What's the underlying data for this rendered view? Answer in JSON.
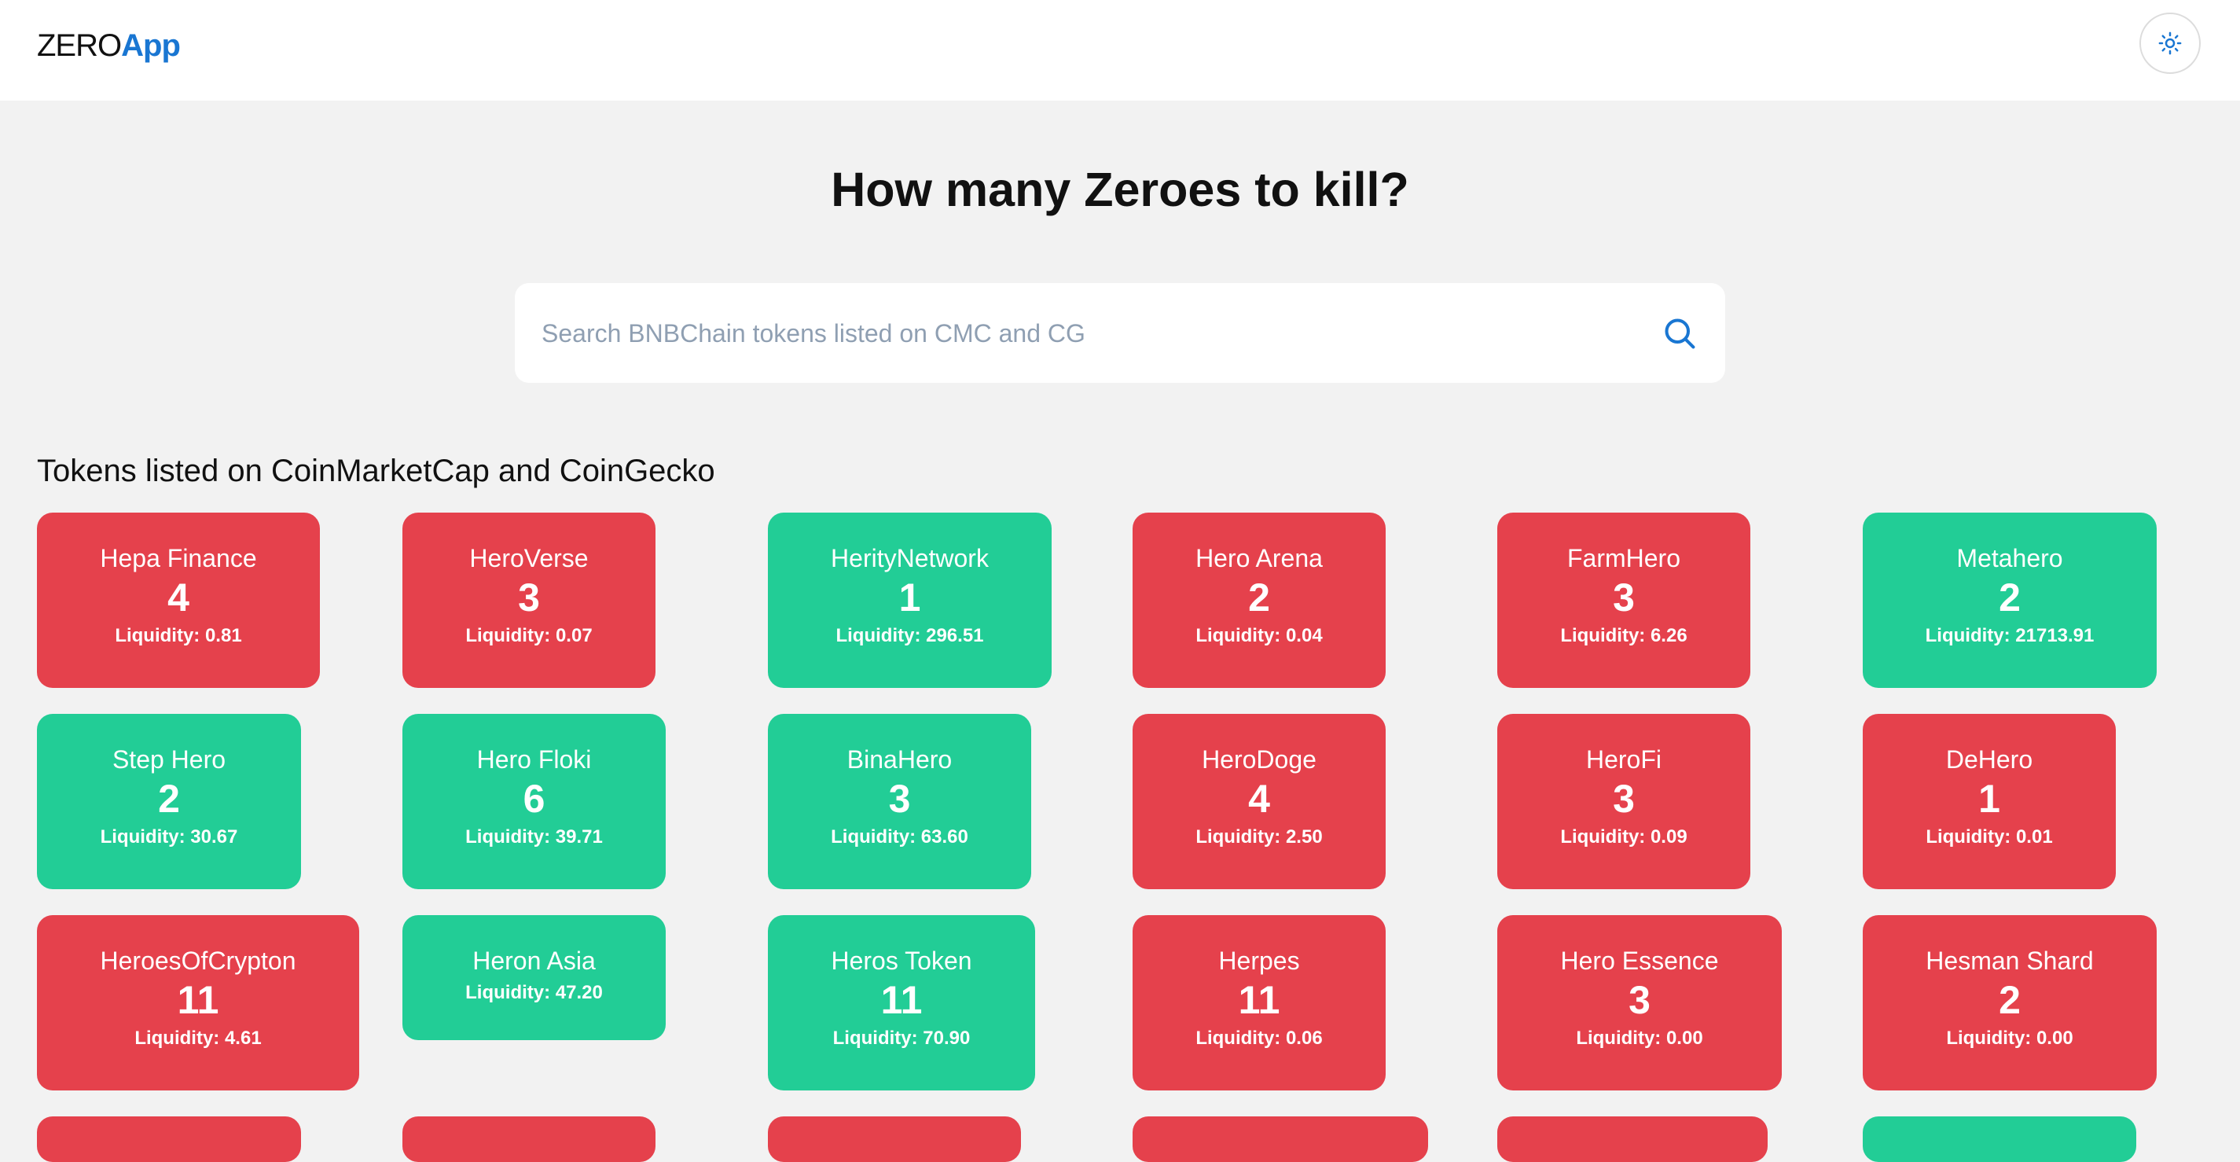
{
  "header": {
    "brand_main": "ZERO",
    "brand_accent": "App",
    "theme_toggle_icon": "sun-icon"
  },
  "hero": {
    "title": "How many Zeroes to kill?"
  },
  "search": {
    "placeholder": "Search BNBChain tokens listed on CMC and CG",
    "value": "",
    "icon": "search-icon"
  },
  "tokens_section": {
    "title": "Tokens listed on CoinMarketCap and CoinGecko"
  },
  "colors": {
    "brand_accent": "#1976d2",
    "card_red": "#e5414c",
    "card_green": "#22cd96",
    "background": "#f2f2f2"
  },
  "tokens": [
    {
      "name": "Hepa Finance",
      "zeros": "4",
      "liquidity": "Liquidity: 0.81",
      "status": "red"
    },
    {
      "name": "HeroVerse",
      "zeros": "3",
      "liquidity": "Liquidity: 0.07",
      "status": "red"
    },
    {
      "name": "HerityNetwork",
      "zeros": "1",
      "liquidity": "Liquidity: 296.51",
      "status": "green"
    },
    {
      "name": "Hero Arena",
      "zeros": "2",
      "liquidity": "Liquidity: 0.04",
      "status": "red"
    },
    {
      "name": "FarmHero",
      "zeros": "3",
      "liquidity": "Liquidity: 6.26",
      "status": "red"
    },
    {
      "name": "Metahero",
      "zeros": "2",
      "liquidity": "Liquidity: 21713.91",
      "status": "green"
    },
    {
      "name": "Step Hero",
      "zeros": "2",
      "liquidity": "Liquidity: 30.67",
      "status": "green"
    },
    {
      "name": "Hero Floki",
      "zeros": "6",
      "liquidity": "Liquidity: 39.71",
      "status": "green"
    },
    {
      "name": "BinaHero",
      "zeros": "3",
      "liquidity": "Liquidity: 63.60",
      "status": "green"
    },
    {
      "name": "HeroDoge",
      "zeros": "4",
      "liquidity": "Liquidity: 2.50",
      "status": "red"
    },
    {
      "name": "HeroFi",
      "zeros": "3",
      "liquidity": "Liquidity: 0.09",
      "status": "red"
    },
    {
      "name": "DeHero",
      "zeros": "1",
      "liquidity": "Liquidity: 0.01",
      "status": "red"
    },
    {
      "name": "HeroesOfCrypton",
      "zeros": "11",
      "liquidity": "Liquidity: 4.61",
      "status": "red"
    },
    {
      "name": "Heron Asia",
      "zeros": "",
      "liquidity": "Liquidity: 47.20",
      "status": "green"
    },
    {
      "name": "Heros Token",
      "zeros": "11",
      "liquidity": "Liquidity: 70.90",
      "status": "green"
    },
    {
      "name": "Herpes",
      "zeros": "11",
      "liquidity": "Liquidity: 0.06",
      "status": "red"
    },
    {
      "name": "Hero Essence",
      "zeros": "3",
      "liquidity": "Liquidity: 0.00",
      "status": "red"
    },
    {
      "name": "Hesman Shard",
      "zeros": "2",
      "liquidity": "Liquidity: 0.00",
      "status": "red"
    },
    {
      "name": "",
      "zeros": "",
      "liquidity": "",
      "status": "red"
    },
    {
      "name": "",
      "zeros": "",
      "liquidity": "",
      "status": "red"
    },
    {
      "name": "",
      "zeros": "",
      "liquidity": "",
      "status": "red"
    },
    {
      "name": "",
      "zeros": "",
      "liquidity": "",
      "status": "red"
    },
    {
      "name": "",
      "zeros": "",
      "liquidity": "",
      "status": "red"
    },
    {
      "name": "",
      "zeros": "",
      "liquidity": "",
      "status": "green"
    }
  ]
}
